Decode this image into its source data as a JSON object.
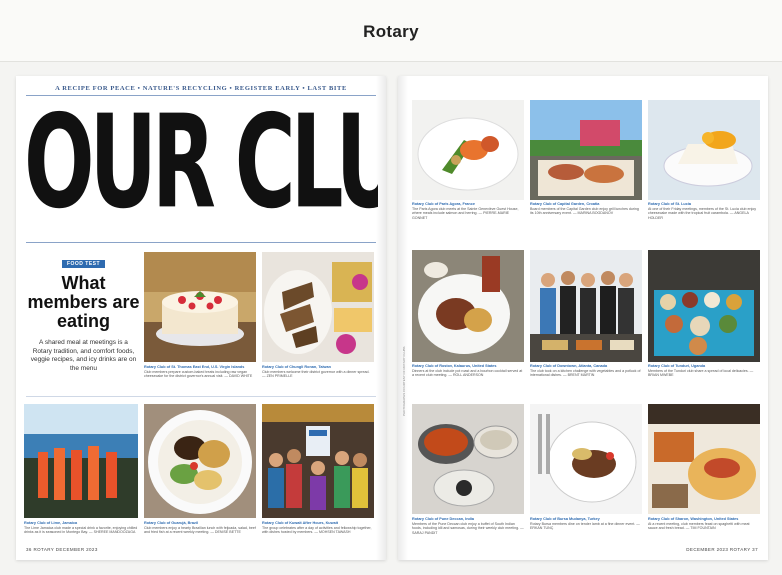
{
  "header": {
    "brand": "Rotary",
    "brand_small": ""
  },
  "left_page": {
    "kicker": "A RECIPE FOR PEACE • NATURE'S RECYCLING • REGISTER EARLY • LAST BITE",
    "headline": "OUR CLUBS",
    "intro": {
      "tag": "FOOD TEST",
      "title": "What members are eating",
      "text": "A shared meal at meetings is a Rotary tradition, and comfort foods, veggie recipes, and icy drinks are on the menu"
    },
    "folio": "36  ROTARY  DECEMBER 2023",
    "cells": [
      {
        "club": "Rotary Club of St. Thomas East End, U.S. Virgin Islands",
        "body": "Club members prepare custom-baked treats including raw vegan cheesecake for the district governor's annual visit.",
        "credit": "DAVID WHITE"
      },
      {
        "club": "Rotary Club of Chungli Ronan, Taiwan",
        "body": "Club members welcome their district governor with a dinner spread.",
        "credit": "ZEN PRIMELLE"
      },
      {
        "club": "Rotary Club of Lime, Jamaica",
        "body": "The Lime Jamaica club made a special drink a favorite, enjoying chilled drinks as it is seasoned in Montego Bay.",
        "credit": "SHEREE MANDOOZAGA"
      },
      {
        "club": "Rotary Club of Guarujá, Brazil",
        "body": "Club members enjoy a hearty Brazilian lunch with feijoada, salad, beef and fried fish at a recent weekly meeting.",
        "credit": "DENISE BETTE"
      },
      {
        "club": "Rotary Club of Kuwait After Hours, Kuwait",
        "body": "The group celebrates after a day of activities and fellowship together, with dishes hosted by members.",
        "credit": "MOHSEN TAWASH"
      }
    ]
  },
  "right_page": {
    "folio": "DECEMBER 2023  ROTARY  37",
    "photo_credit": "PHOTOGRAPHS COURTESY OF ROTARY CLUBS",
    "cells": [
      {
        "club": "Rotary Club of Paris Agora, France",
        "body": "The Paris Agora club meets at the Sainte Geneviève Guest House, where meals include salmon and herring.",
        "credit": "PIERRE-MARIE GONNET"
      },
      {
        "club": "Rotary Club of Capital Garden, Croatia",
        "body": "Board members of the Capital Garden club enjoy grill lunches during its 10th anniversary event.",
        "credit": "MARINA BOGDANOV"
      },
      {
        "club": "Rotary Club of St. Lucia",
        "body": "At one of their Friday meetings, members of the St. Lucia club enjoy cheesecake made with the tropical fruit carambola.",
        "credit": "ANGELA HOLDER"
      },
      {
        "club": "Rotary Club of Rostov, Kalaurus, United States",
        "body": "Dinners at the club include pot roast and a bourbon cocktail served at a recent club meeting.",
        "credit": "ROLL ANDERSON"
      },
      {
        "club": "Rotary Club of Downtown, Atlanta, Canada",
        "body": "The club took on a kitchen challenge with vegetables and a potluck of international dishes.",
        "credit": "BRENT MARTIN"
      },
      {
        "club": "Rotary Club of Tunduri, Uganda",
        "body": "Members of the Tunduri club share a spread of local delicacies.",
        "credit": "BRIAN MWEBE"
      },
      {
        "club": "Rotary Club of Pune Deccan, India",
        "body": "Members of the Pune Deccan club enjoy a buffet of South Indian foods, including idli and samosas, during their weekly club meeting.",
        "credit": "SARAJ PANDIT"
      },
      {
        "club": "Rotary Club of Bursa Mudanya, Turkey",
        "body": "Rotary Bursa members dine on tender lamb at a fine dinner event.",
        "credit": "ERKAN TUNÇ"
      },
      {
        "club": "Rotary Club of Sharon, Washington, United States",
        "body": "At a recent meeting, club members feast on spaghetti with meat sauce and fresh bread.",
        "credit": "TIM FOUNTAIN"
      }
    ]
  }
}
